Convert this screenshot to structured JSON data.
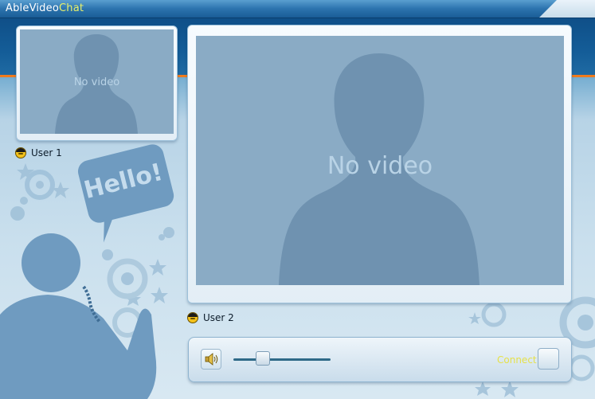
{
  "app": {
    "brand_part1": "Able",
    "brand_part2": "Video",
    "brand_part3": "Chat"
  },
  "local_video": {
    "placeholder": "No video",
    "user_label": "User 1"
  },
  "remote_video": {
    "placeholder": "No video",
    "user_label": "User 2"
  },
  "decoration": {
    "bubble_text": "Hello!"
  },
  "controls": {
    "connect_label": "Connect",
    "volume_level": 0.3
  },
  "icons": {
    "speaker": "speaker-icon",
    "user": "user-avatar-icon",
    "connect": "connect-icon"
  },
  "colors": {
    "accent_orange": "#f07b1c",
    "connect_text": "#e6e14a",
    "brand_accent": "#e8f06a",
    "video_bg": "#8aabc5"
  }
}
